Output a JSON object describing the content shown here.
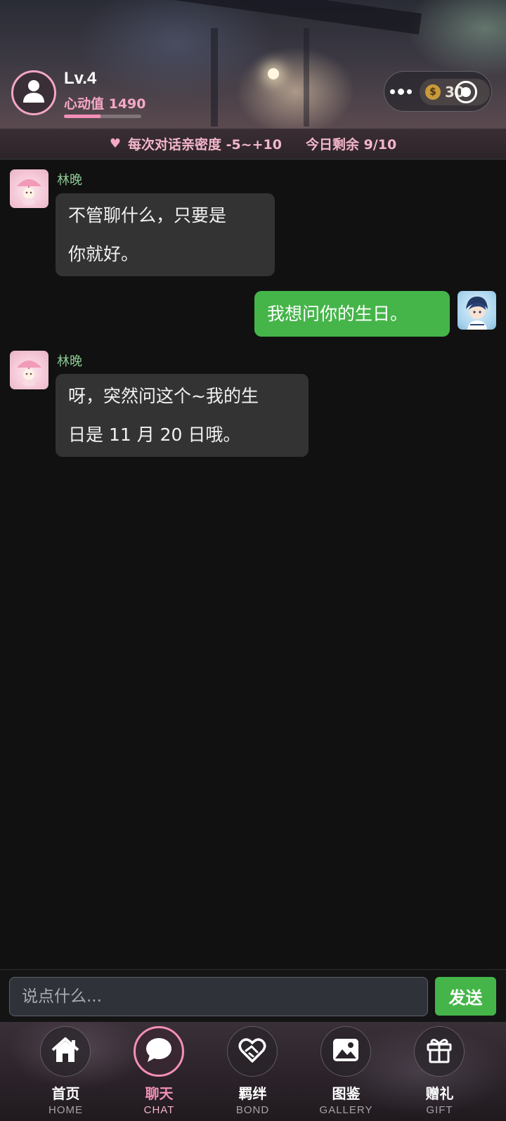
{
  "header": {
    "level": "Lv.4",
    "heart_label": "心动值 1490",
    "heart_progress": 0.47,
    "coins": "30",
    "avatar_icon": "user-icon",
    "more_icon": "more-dots-icon",
    "capsule_icon": "target-circle-icon",
    "coin_icon": "coin-dollar-icon"
  },
  "notice": {
    "icon": "heart-icon",
    "intimacy_text": "每次对话亲密度 -5~+10",
    "remaining_text": "今日剩余 9/10"
  },
  "messages": [
    {
      "role": "npc",
      "name": "林晚",
      "lines": [
        "不管聊什么，只要是",
        "你就好。"
      ]
    },
    {
      "role": "user",
      "lines": [
        "我想问你的生日。"
      ]
    },
    {
      "role": "npc",
      "name": "林晚",
      "lines": [
        "呀，突然问这个~我的生",
        "日是 11 月 20 日哦。"
      ]
    }
  ],
  "input": {
    "placeholder": "说点什么...",
    "value": "",
    "send_label": "发送"
  },
  "nav": {
    "items": [
      {
        "label": "首页",
        "sub": "HOME",
        "icon": "home-icon",
        "active": false
      },
      {
        "label": "聊天",
        "sub": "CHAT",
        "icon": "chat-bubble-icon",
        "active": true
      },
      {
        "label": "羁绊",
        "sub": "BOND",
        "icon": "handshake-heart-icon",
        "active": false
      },
      {
        "label": "图鉴",
        "sub": "GALLERY",
        "icon": "image-icon",
        "active": false
      },
      {
        "label": "赠礼",
        "sub": "GIFT",
        "icon": "gift-icon",
        "active": false
      }
    ]
  },
  "colors": {
    "accent_pink": "#f38fb7",
    "user_bubble": "#45b549",
    "npc_bubble": "#333333",
    "name_green": "#8ccc93",
    "background": "#111111"
  }
}
